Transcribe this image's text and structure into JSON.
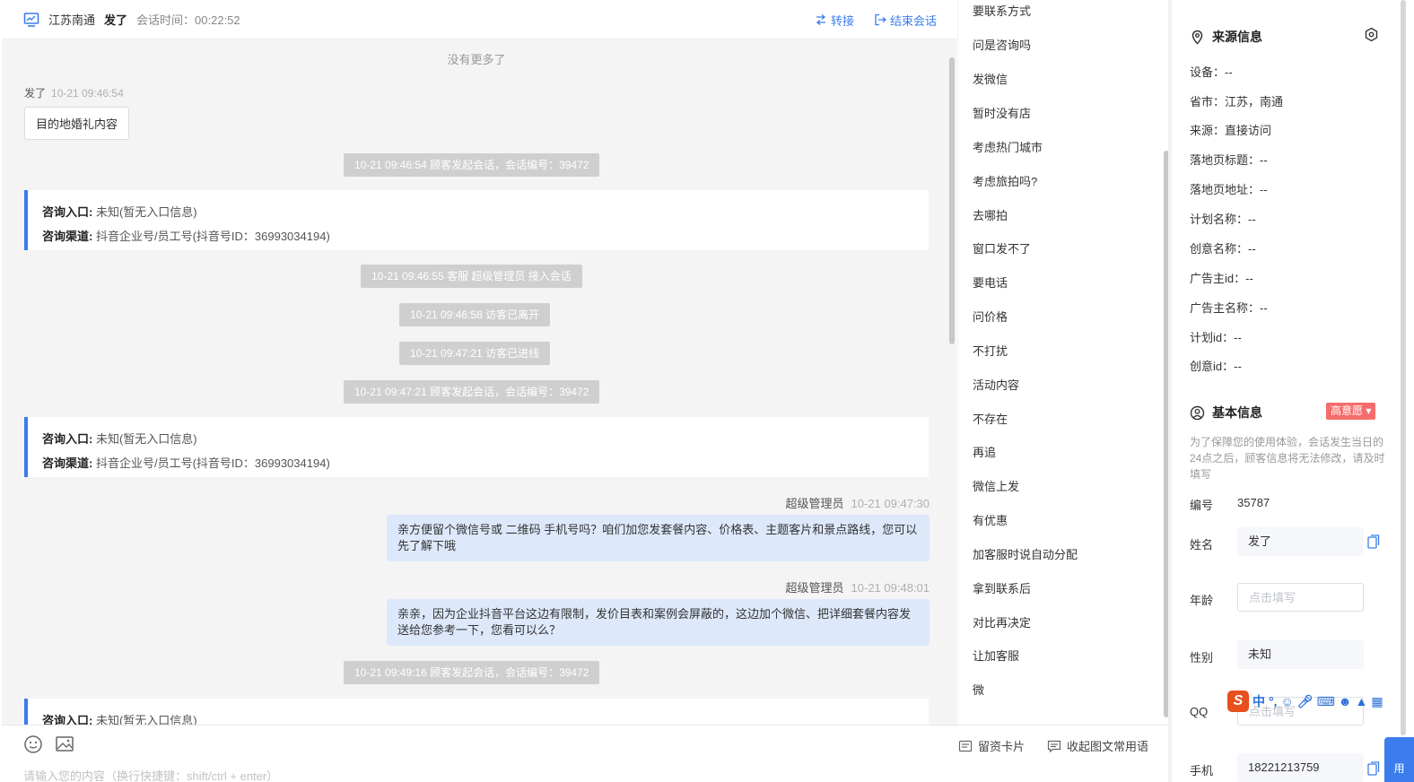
{
  "header": {
    "city": "江苏南通",
    "visitor_name": "发了",
    "session_time_label": "会话时间：00:22:52",
    "transfer_label": "转接",
    "end_session_label": "结束会话"
  },
  "chat": {
    "no_more": "没有更多了",
    "visitor_message": {
      "name": "发了",
      "time": "10-21 09:46:54",
      "text": "目的地婚礼内容"
    },
    "system": [
      "10-21 09:46:54 顾客发起会话，会话编号：39472",
      "10-21 09:46:55 客服 超级管理员 接入会话",
      "10-21 09:46:58 访客已离开",
      "10-21 09:47:21 访客已进线",
      "10-21 09:47:21 顾客发起会话，会话编号：39472",
      "10-21 09:49:16 顾客发起会话，会话编号：39472"
    ],
    "info_block": {
      "entry_label": "咨询入口:",
      "entry_value": "未知(暂无入口信息)",
      "channel_label": "咨询渠道:",
      "channel_value": "抖音企业号/员工号(抖音号ID：36993034194)"
    },
    "agent_messages": [
      {
        "name": "超级管理员",
        "time": "10-21 09:47:30",
        "text": "亲方便留个微信号或 二维码 手机号吗？咱们加您发套餐内容、价格表、主题客片和景点路线，您可以先了解下哦"
      },
      {
        "name": "超级管理员",
        "time": "10-21 09:48:01",
        "text": "亲亲，因为企业抖音平台这边有限制，发价目表和案例会屏蔽的，这边加个微信、把详细套餐内容发送给您参考一下，您看可以么？"
      }
    ]
  },
  "input": {
    "placeholder": "请输入您的内容（换行快捷键：shift/ctrl + enter）",
    "lead_card_label": "留资卡片",
    "collapse_label": "收起图文常用语"
  },
  "quick_replies": [
    "要联系方式",
    "问是咨询吗",
    "发微信",
    "暂时没有店",
    "考虑热门城市",
    "考虑旅拍吗?",
    "去哪拍",
    "窗口发不了",
    "要电话",
    "问价格",
    "不打扰",
    "活动内容",
    "不存在",
    "再追",
    "微信上发",
    "有优惠",
    "加客服时说自动分配",
    "拿到联系后",
    "对比再决定",
    "让加客服",
    "微"
  ],
  "source_info": {
    "title": "来源信息",
    "rows": [
      "设备：--",
      "省市：江苏，南通",
      "来源：直接访问",
      "落地页标题：--",
      "落地页地址：--",
      "计划名称：--",
      "创意名称：--",
      "广告主id：--",
      "广告主名称：--",
      "计划id：--",
      "创意id：--"
    ]
  },
  "basic_info": {
    "title": "基本信息",
    "intent_badge": "高意愿",
    "note": "为了保障您的使用体验，会话发生当日的24点之后，顾客信息将无法修改，请及时填写",
    "id_label": "编号",
    "id_value": "35787",
    "name_label": "姓名",
    "name_value": "发了",
    "age_label": "年龄",
    "age_placeholder": "点击填写",
    "gender_label": "性别",
    "gender_value": "未知",
    "qq_label": "QQ",
    "qq_placeholder": "点击填写",
    "phone_label": "手机",
    "phone_value": "18221213759"
  },
  "ime": {
    "zh": "中",
    "punct": "°,"
  },
  "help_btn": "用",
  "colors": {
    "accent": "#3b7ded",
    "badge": "#f56c6c",
    "agent_bubble": "#dde8fb",
    "system_pill": "#cfcfcf"
  }
}
